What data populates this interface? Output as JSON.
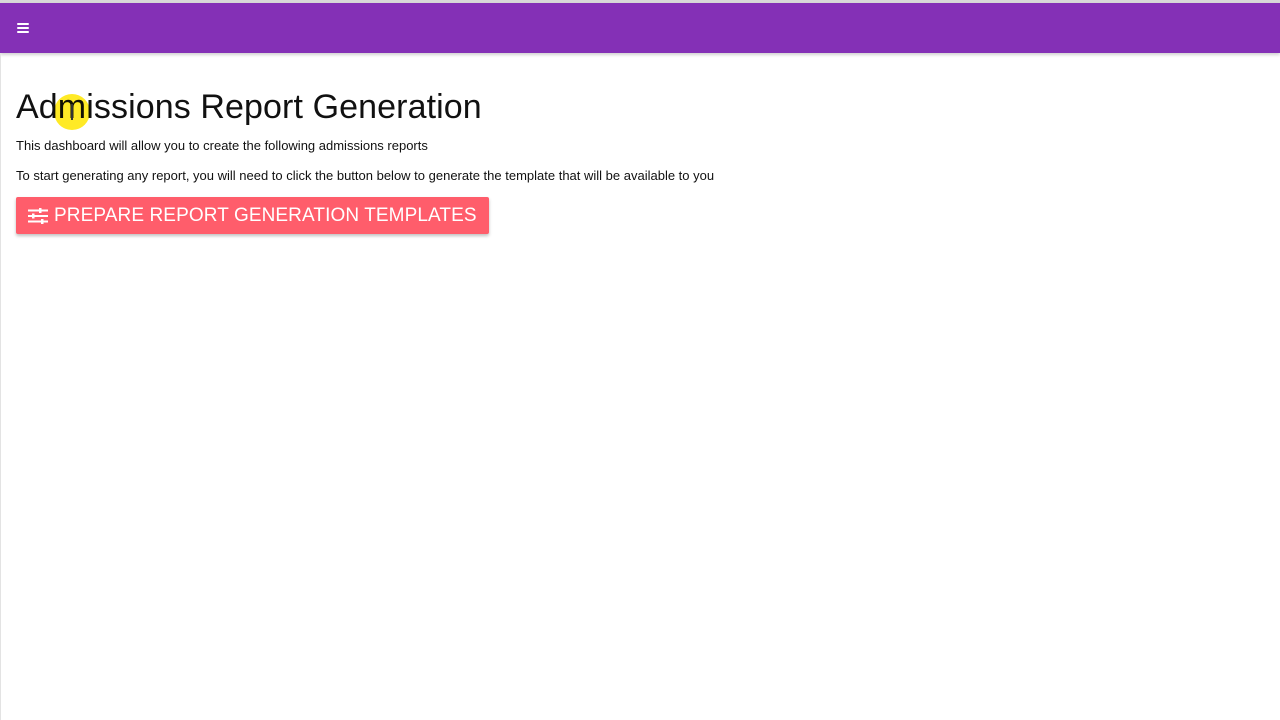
{
  "appbar": {
    "color": "#8430b6",
    "menu_icon": "menu-icon"
  },
  "main": {
    "title": "Admissions Report Generation",
    "description": "This dashboard will allow you to create the following admissions reports",
    "instruction": "To start generating any report, you will need to click the button below to generate the template that will be available to you",
    "prepare_button": {
      "label": "PREPARE REPORT GENERATION TEMPLATES",
      "icon": "tune-icon",
      "color": "#ff5d6b"
    }
  }
}
